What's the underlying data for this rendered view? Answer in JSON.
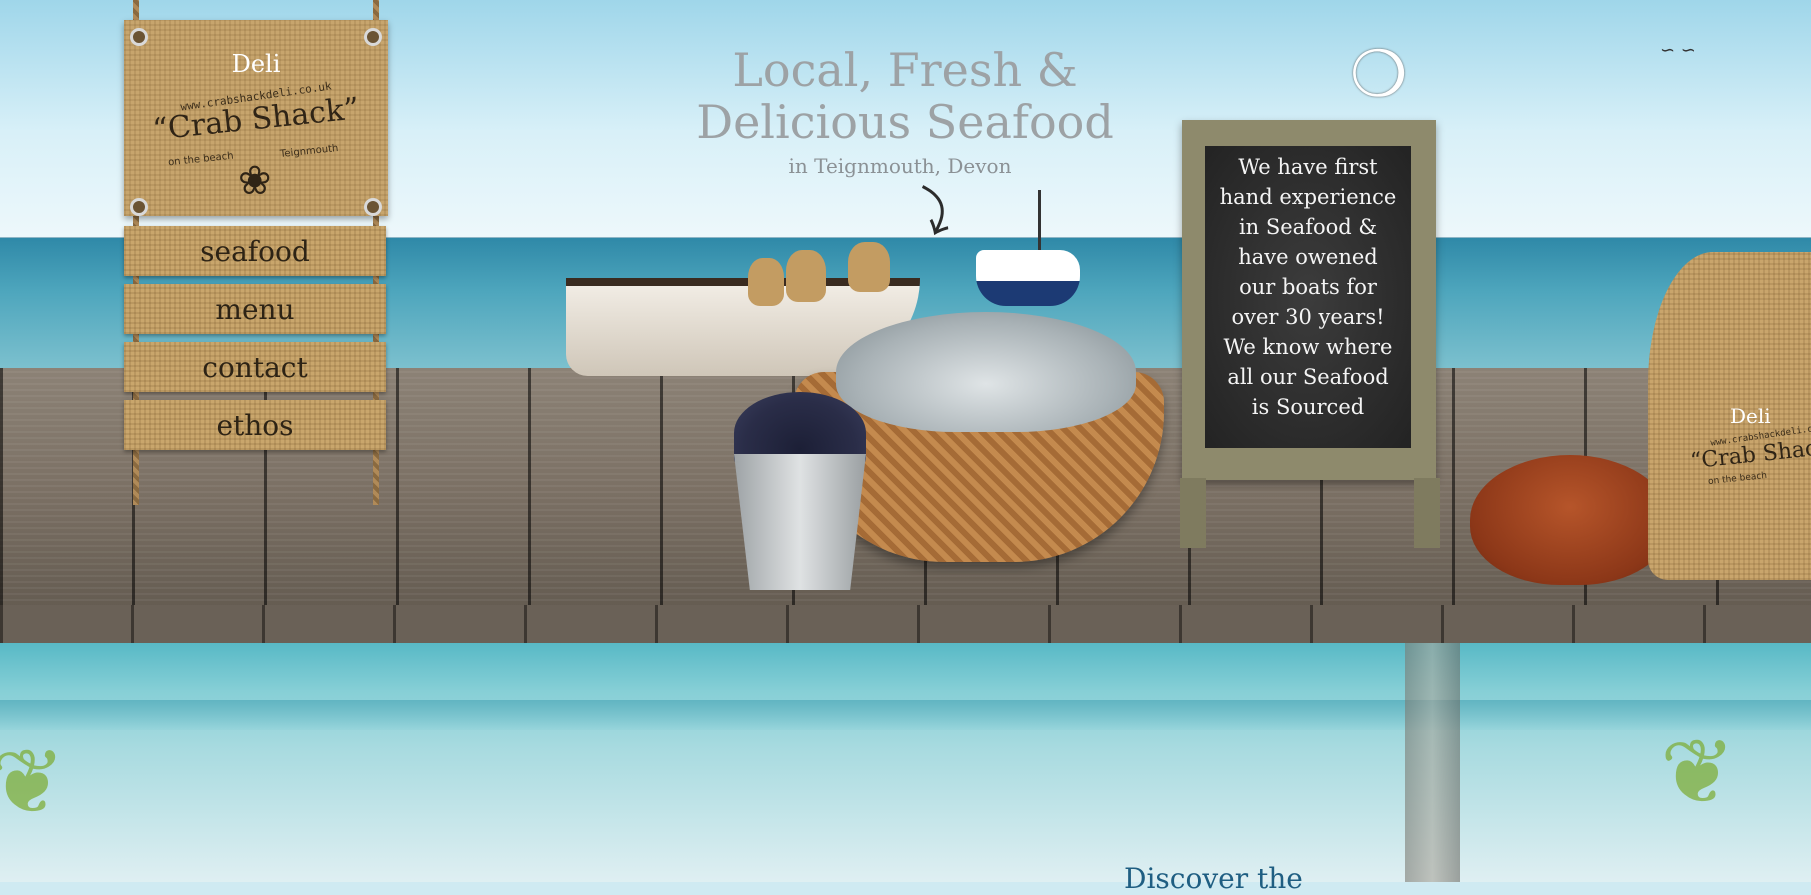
{
  "site": {
    "sign": {
      "deli": "Deli",
      "url": "www.crabshackdeli.co.uk",
      "brand": "“Crab Shack”",
      "tagline_left": "on the beach",
      "tagline_right": "Teignmouth"
    },
    "nav": [
      {
        "label": "seafood"
      },
      {
        "label": "menu"
      },
      {
        "label": "contact"
      },
      {
        "label": "ethos"
      }
    ]
  },
  "hero": {
    "headline_line1": "Local, Fresh &",
    "headline_line2": "Delicious Seafood",
    "subtitle": "in Teignmouth, Devon"
  },
  "chalkboard": {
    "lines": [
      "We have first",
      "hand experience",
      "in Seafood &",
      "have owened",
      "our boats for",
      "over 30 years!",
      "We know where",
      "all our Seafood",
      "is Sourced"
    ]
  },
  "sack": {
    "deli": "Deli",
    "url": "www.crabshackdeli.co.uk",
    "brand": "“Crab Shack",
    "tagline": "on the beach"
  },
  "footer_teaser": {
    "text": "Discover the"
  },
  "icons": {
    "crab": "crab-icon",
    "arrow": "curved-arrow-icon",
    "gull": "seagull-icon"
  }
}
